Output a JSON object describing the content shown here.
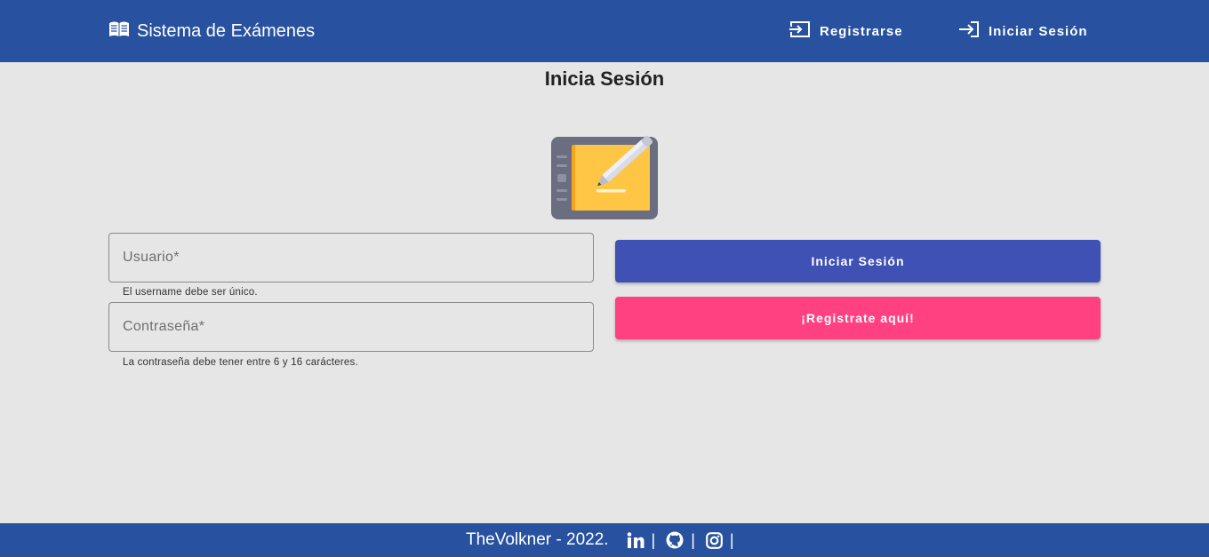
{
  "navbar": {
    "brand_icon": "open-book-icon",
    "brand_title": "Sistema de Exámenes",
    "register_icon": "register-arrow-icon",
    "register_label": "Registrarse",
    "login_icon": "login-arrow-icon",
    "login_label": "Iniciar Sesión"
  },
  "main": {
    "title": "Inicia Sesión",
    "illustration_icon": "tablet-pencil-icon",
    "username": {
      "placeholder": "Usuario*",
      "value": "",
      "hint": "El username debe ser único."
    },
    "password": {
      "placeholder": "Contraseña*",
      "value": "",
      "hint": "La contraseña debe tener entre 6 y 16 carácteres."
    },
    "login_button": "Iniciar Sesión",
    "register_button": "¡Registrate aquí!"
  },
  "footer": {
    "text": "TheVolkner - 2022.",
    "links": [
      "linkedin-icon",
      "github-icon",
      "instagram-icon"
    ],
    "separator": "|"
  },
  "colors": {
    "primary": "#28529f",
    "background": "#e6e6e6",
    "login_button": "#3f51b5",
    "register_button": "#ff4081"
  }
}
